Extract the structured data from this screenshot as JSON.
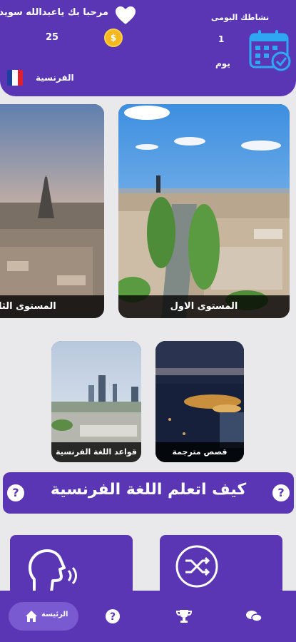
{
  "header": {
    "greeting": "مرحبا بك ياعبدالله سويد",
    "coins": "25",
    "coin_icon": "coin-icon",
    "language": "الفرنسية",
    "activity_title": "نشاطك اليومى",
    "days_count": "1",
    "days_label": "يوم"
  },
  "levels": [
    {
      "label": "المستوى الاول"
    },
    {
      "label": "المستوى الثاني"
    }
  ],
  "sections": {
    "stories": "قصص مترجمة",
    "grammar": "قواعد اللغة الفرنسية"
  },
  "banner": {
    "title": "كيف اتعلم اللغة الفرنسية"
  },
  "nav": {
    "home_label": "الرئيسة"
  },
  "colors": {
    "primary": "#5a36b5",
    "background": "#e9e9ec",
    "coin": "#f5b81f"
  }
}
